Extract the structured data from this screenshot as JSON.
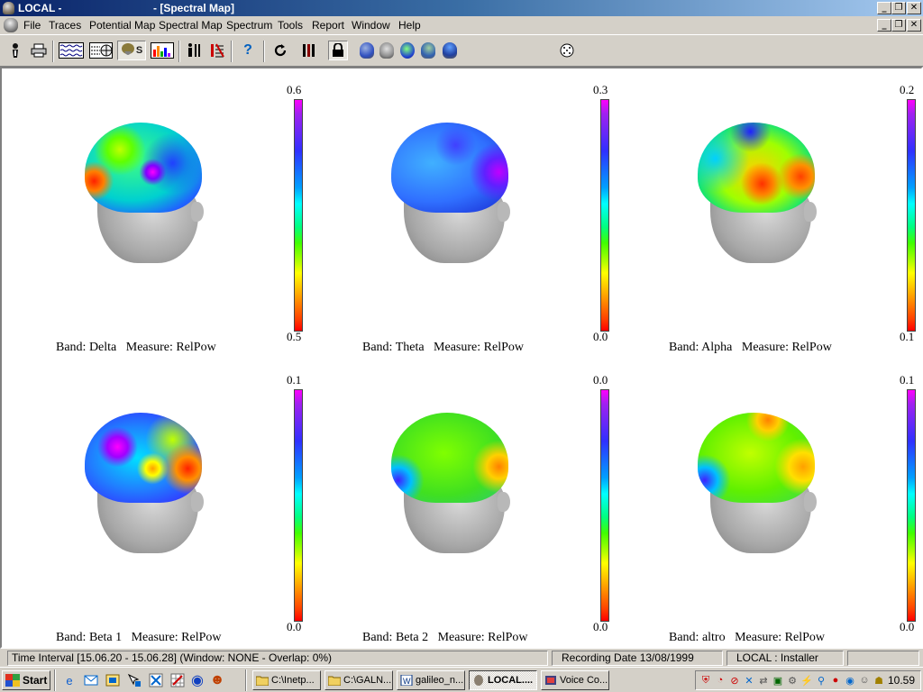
{
  "window": {
    "title_left": "LOCAL -",
    "title_right": "- [Spectral Map]",
    "caption_buttons": [
      "_",
      "❐",
      "✕"
    ],
    "mdi_buttons": [
      "_",
      "❐",
      "✕"
    ]
  },
  "menu": {
    "items": [
      "File",
      "Traces",
      "Potential Map",
      "Spectral Map",
      "Spectrum",
      "Tools",
      "Report",
      "Window",
      "Help"
    ]
  },
  "toolbar": {
    "icons": [
      "eeg-person-icon",
      "print-icon",
      "traces-view-icon",
      "montage-view-icon",
      "spectral-map-icon",
      "spectrum-view-icon",
      "electrode-person-icon",
      "events-icon",
      "help-icon",
      "refresh-icon",
      "bars-icon",
      "lock-icon",
      "head-left-icon",
      "head-front-icon",
      "head-top-icon",
      "head-right-icon",
      "head-back-icon",
      "slider",
      "electrode-cap-icon"
    ],
    "help_glyph": "?",
    "spectral_label": "S"
  },
  "maps": [
    {
      "band": "Delta",
      "measure": "RelPow",
      "scale_top": "0.6",
      "scale_bottom": "0.5",
      "caption": "Band: Delta   Measure: RelPow"
    },
    {
      "band": "Theta",
      "measure": "RelPow",
      "scale_top": "0.3",
      "scale_bottom": "0.0",
      "caption": "Band: Theta   Measure: RelPow"
    },
    {
      "band": "Alpha",
      "measure": "RelPow",
      "scale_top": "0.2",
      "scale_bottom": "0.1",
      "caption": "Band: Alpha   Measure: RelPow"
    },
    {
      "band": "Beta 1",
      "measure": "RelPow",
      "scale_top": "0.1",
      "scale_bottom": "0.0",
      "caption": "Band: Beta 1   Measure: RelPow"
    },
    {
      "band": "Beta 2",
      "measure": "RelPow",
      "scale_top": "0.0",
      "scale_bottom": "0.0",
      "caption": "Band: Beta 2   Measure: RelPow"
    },
    {
      "band": "altro",
      "measure": "RelPow",
      "scale_top": "0.1",
      "scale_bottom": "0.0",
      "caption": "Band: altro   Measure: RelPow"
    }
  ],
  "status": {
    "time_interval": "Time Interval [15.06.20 - 15.06.28] (Window: NONE - Overlap: 0%)",
    "recording_date": "Recording Date 13/08/1999",
    "user": "LOCAL : Installer"
  },
  "taskbar": {
    "start_label": "Start",
    "buttons": [
      "C:\\Inetp...",
      "C:\\GALN...",
      "galileo_n...",
      "LOCAL....",
      "Voice Co..."
    ],
    "clock": "10.59"
  }
}
